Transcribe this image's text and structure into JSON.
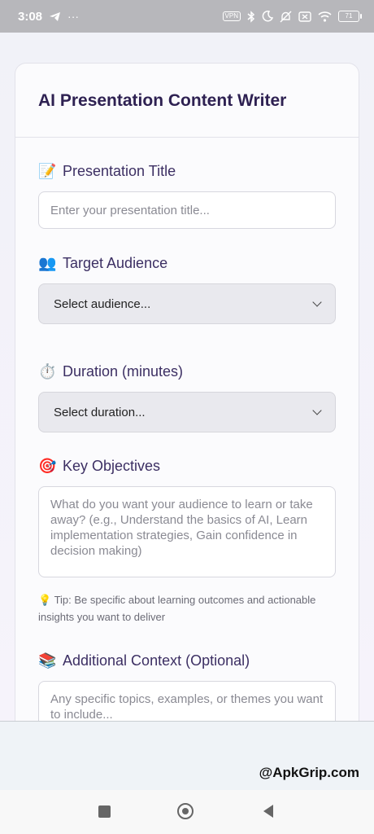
{
  "status_bar": {
    "time": "3:08",
    "left_icons": [
      "telegram-icon",
      "more-dots-icon"
    ],
    "vpn": "VPN",
    "battery": "71"
  },
  "app": {
    "title": "AI Presentation Content Writer"
  },
  "form": {
    "title_field": {
      "emoji": "📝",
      "label": "Presentation Title",
      "placeholder": "Enter your presentation title..."
    },
    "audience_field": {
      "emoji": "👥",
      "label": "Target Audience",
      "selected": "Select audience..."
    },
    "duration_field": {
      "emoji": "⏱️",
      "label": "Duration (minutes)",
      "selected": "Select duration..."
    },
    "objectives_field": {
      "emoji": "🎯",
      "label": "Key Objectives",
      "placeholder": "What do you want your audience to learn or take away? (e.g., Understand the basics of AI, Learn implementation strategies, Gain confidence in decision making)"
    },
    "tip": "💡 Tip: Be specific about learning outcomes and actionable insights you want to deliver",
    "context_field": {
      "emoji": "📚",
      "label": "Additional Context (Optional)",
      "placeholder": "Any specific topics, examples, or themes you want to include..."
    }
  },
  "watermark": "@ApkGrip.com"
}
